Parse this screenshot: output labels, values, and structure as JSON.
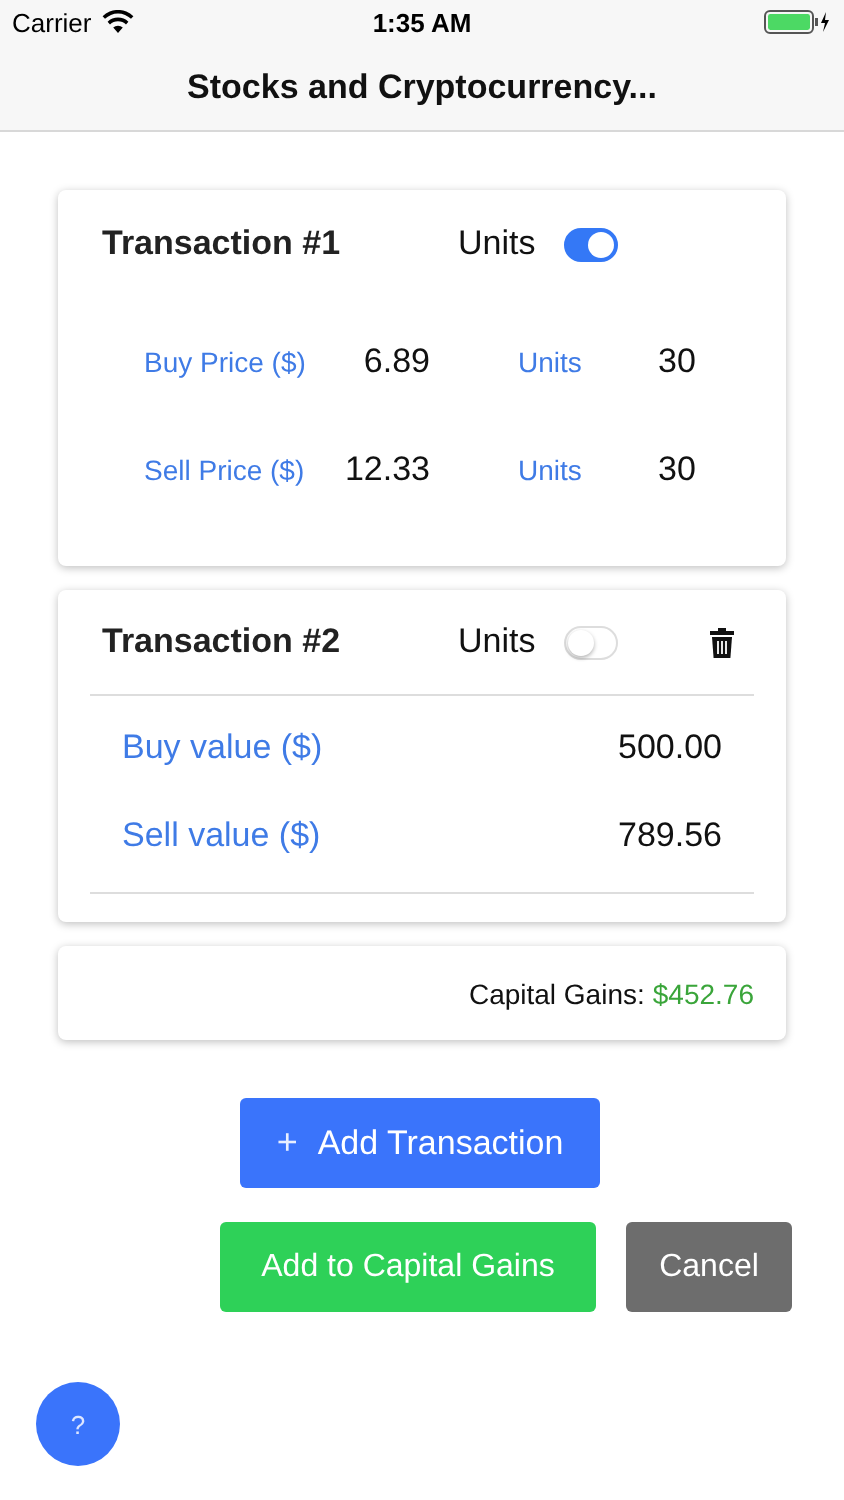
{
  "status_bar": {
    "carrier": "Carrier",
    "time": "1:35 AM"
  },
  "nav_bar": {
    "title": "Stocks and Cryptocurrency..."
  },
  "transactions": [
    {
      "kind": "price",
      "title": "Transaction #1",
      "toggle_label": "Units",
      "units_on": true,
      "deletable": false,
      "rows": [
        {
          "label": "Buy Price ($)",
          "value": "6.89",
          "units_label": "Units",
          "units": "30"
        },
        {
          "label": "Sell Price ($)",
          "value": "12.33",
          "units_label": "Units",
          "units": "30"
        }
      ]
    },
    {
      "kind": "value",
      "title": "Transaction #2",
      "toggle_label": "Units",
      "units_on": false,
      "deletable": true,
      "rows": [
        {
          "label": "Buy value ($)",
          "value": "500.00"
        },
        {
          "label": "Sell value ($)",
          "value": "789.56"
        }
      ]
    }
  ],
  "summary": {
    "label": "Capital Gains:",
    "amount": "$452.76"
  },
  "add_button": {
    "icon": "+",
    "label": "Add Transaction"
  },
  "buttons": [
    {
      "kind": "primary",
      "label": "Add to Capital Gains"
    },
    {
      "kind": "secondary",
      "label": "Cancel"
    }
  ],
  "help_button": "?"
}
